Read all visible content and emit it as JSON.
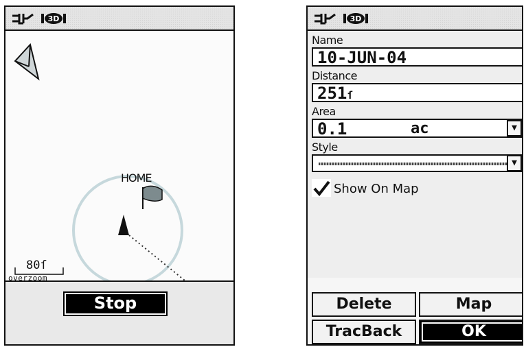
{
  "left_screen": {
    "status_icons": [
      "antenna-icon",
      "3d-fix-icon"
    ],
    "status_3d": "3D",
    "map": {
      "waypoint_label": "HOME",
      "scale_label": "80ſ",
      "zoom_note": "overzoom"
    },
    "stop_label": "Stop"
  },
  "right_screen": {
    "status_icons": [
      "antenna-icon",
      "3d-fix-icon"
    ],
    "status_3d": "3D",
    "name_label": "Name",
    "name_value": "10-JUN-04",
    "distance_label": "Distance",
    "distance_value": "251",
    "distance_unit": "ſ",
    "area_label": "Area",
    "area_value": "0.1",
    "area_unit": "ac",
    "style_label": "Style",
    "show_on_map_label": "Show On Map",
    "show_on_map_checked": true,
    "buttons": {
      "delete": "Delete",
      "map": "Map",
      "tracback": "TracBack",
      "ok": "OK"
    }
  }
}
